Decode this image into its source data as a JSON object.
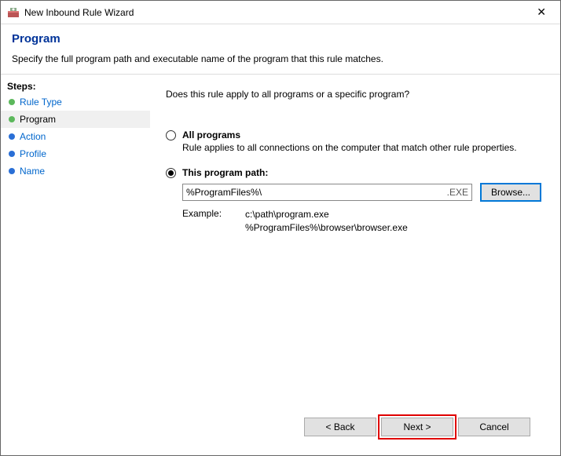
{
  "titlebar": {
    "text": "New Inbound Rule Wizard"
  },
  "header": {
    "title": "Program",
    "description": "Specify the full program path and executable name of the program that this rule matches."
  },
  "sidebar": {
    "heading": "Steps:",
    "items": [
      {
        "label": "Rule Type",
        "bullet": "green",
        "link": true
      },
      {
        "label": "Program",
        "bullet": "green",
        "current": true
      },
      {
        "label": "Action",
        "bullet": "blue",
        "link": true
      },
      {
        "label": "Profile",
        "bullet": "blue",
        "link": true
      },
      {
        "label": "Name",
        "bullet": "blue",
        "link": true
      }
    ]
  },
  "content": {
    "question": "Does this rule apply to all programs or a specific program?",
    "option_all": {
      "label": "All programs",
      "desc": "Rule applies to all connections on the computer that match other rule properties."
    },
    "option_path": {
      "label": "This program path:",
      "value": "%ProgramFiles%\\",
      "ext": ".EXE",
      "browse": "Browse..."
    },
    "example": {
      "label": "Example:",
      "line1": "c:\\path\\program.exe",
      "line2": "%ProgramFiles%\\browser\\browser.exe"
    }
  },
  "footer": {
    "back": "< Back",
    "next": "Next >",
    "cancel": "Cancel"
  }
}
